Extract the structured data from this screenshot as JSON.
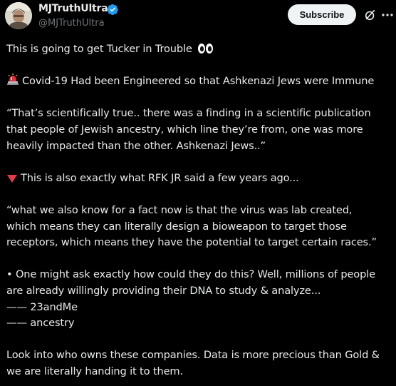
{
  "author": {
    "display_name": "MJTruthUltra",
    "handle": "@MJTruthUltra"
  },
  "actions": {
    "subscribe_label": "Subscribe"
  },
  "icons": {
    "verified": "verified-badge-icon",
    "grok": "grok-icon",
    "more": "more-icon",
    "siren": "police-light-emoji",
    "triangle": "red-triangle-down-emoji",
    "eyes": "eyes-emoji"
  },
  "colors": {
    "background": "#000000",
    "text": "#e7e9ea",
    "secondary": "#71767b",
    "verified": "#1d9bf0",
    "subscribe_bg": "#eff3f4"
  },
  "tweet": {
    "p1": "This is going to get Tucker in Trouble",
    "p2": "Covid-19 Had been Engineered so that Ashkenazi Jews were Immune",
    "p3_l1": "“That’s scientifically true.. there was a finding in a scientific publication",
    "p3_l2": "that people of Jewish ancestry, which line they’re from, one was more",
    "p3_l3": "heavily impacted than the other. Ashkenazi Jews..”",
    "p4": "This is also exactly what RFK JR said a few years ago...",
    "p5_l1": "“what we also know for a fact now is that the virus was lab created,",
    "p5_l2": "which means they can literally design a bioweapon to target those",
    "p5_l3": "receptors, which means they have the potential to target certain races.”",
    "p6_l1": "• One might ask exactly how could they do this? Well, millions of people",
    "p6_l2": "are already willingly providing their DNA to study & analyze...",
    "p6_l3": "—— 23andMe",
    "p6_l4": "—— ancestry",
    "p7_l1": "Look into who owns these companies. Data is more precious than Gold &",
    "p7_l2": "we are literally handing it to them."
  }
}
